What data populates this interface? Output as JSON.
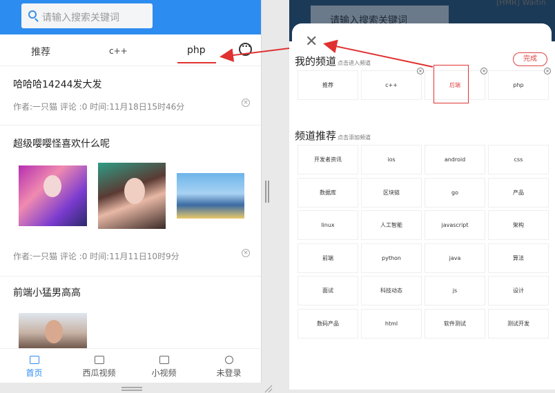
{
  "left_app": {
    "search_placeholder": "请输入搜索关键词",
    "tabs": [
      {
        "label": "推荐"
      },
      {
        "label": "c++"
      },
      {
        "label": "php"
      }
    ],
    "articles": [
      {
        "title": "哈哈哈14244发大发",
        "meta": "作者:一只猫 评论 :0 时间:11月18日15时46分"
      },
      {
        "title": "超级嘤嘤怪喜欢什么呢",
        "meta": "作者:一只猫 评论 :0 时间:11月11日10时9分"
      },
      {
        "title": "前端小猛男高高",
        "meta": ""
      }
    ],
    "bottom_nav": [
      {
        "label": "首页",
        "icon": "home-icon"
      },
      {
        "label": "西瓜视频",
        "icon": "video-icon"
      },
      {
        "label": "小视频",
        "icon": "short-video-icon"
      },
      {
        "label": "未登录",
        "icon": "user-icon"
      }
    ]
  },
  "right_app": {
    "search_placeholder": "请输入搜索关键词",
    "waiting_text": "[HMR] Waitin",
    "my_channels_title": "我的频道",
    "my_channels_hint": "点击进入频道",
    "done_label": "完成",
    "my_channels": [
      "推荐",
      "c++",
      "后端",
      "php"
    ],
    "recommend_title": "频道推荐",
    "recommend_hint": "点击添加频道",
    "recommend_channels": [
      "开发者资讯",
      "ios",
      "android",
      "css",
      "数据库",
      "区块链",
      "go",
      "产品",
      "linux",
      "人工智能",
      "javascript",
      "架构",
      "前端",
      "python",
      "java",
      "算法",
      "面试",
      "科技动态",
      "js",
      "设计",
      "数码产品",
      "html",
      "软件测试",
      "测试开发"
    ]
  },
  "colors": {
    "header_blue": "#2d8cf0",
    "accent_red": "#e0312e",
    "dark_header": "#1b3a57"
  }
}
